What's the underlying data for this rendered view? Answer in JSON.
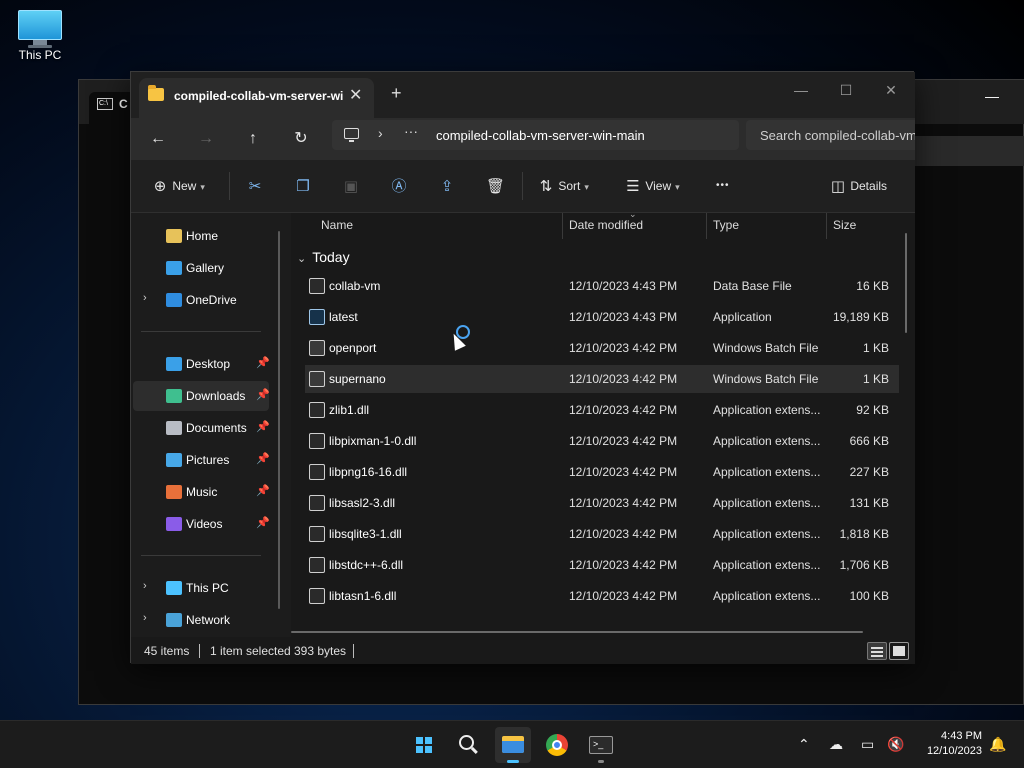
{
  "desktop": {
    "icon_label": "This PC"
  },
  "cmd": {
    "title_char": "C",
    "icon_text": "C:\\"
  },
  "explorer": {
    "tab_title": "compiled-collab-vm-server-wi",
    "tab_close": "✕",
    "new_tab": "+",
    "minimize": "—",
    "maximize": "☐",
    "close": "✕",
    "address": {
      "dots": "···",
      "chevron": "›",
      "path": "compiled-collab-vm-server-win-main"
    },
    "search_placeholder": "Search compiled-collab-vm-server-win-main",
    "commands": {
      "new": "New",
      "sort": "Sort",
      "view": "View",
      "more": "•••",
      "details": "Details"
    },
    "nav": {
      "quick": [
        {
          "label": "Home",
          "icon": "home-icon",
          "color": "#e7c25a"
        },
        {
          "label": "Gallery",
          "icon": "gallery-icon",
          "color": "#3aa0e8"
        },
        {
          "label": "OneDrive",
          "icon": "cloud-icon",
          "color": "#2f8de0"
        }
      ],
      "pinned": [
        {
          "label": "Desktop",
          "icon": "desktop-icon",
          "color": "#3aa0e8"
        },
        {
          "label": "Downloads",
          "icon": "download-icon",
          "color": "#3fbf8f"
        },
        {
          "label": "Documents",
          "icon": "document-icon",
          "color": "#b8bcc4"
        },
        {
          "label": "Pictures",
          "icon": "pictures-icon",
          "color": "#47a8e8"
        },
        {
          "label": "Music",
          "icon": "music-icon",
          "color": "#e8703a"
        },
        {
          "label": "Videos",
          "icon": "video-icon",
          "color": "#8a5ce8"
        }
      ],
      "devices": [
        {
          "label": "This PC",
          "icon": "pc-icon",
          "color": "#4cc2ff"
        },
        {
          "label": "Network",
          "icon": "network-icon",
          "color": "#4aa3d8"
        }
      ]
    },
    "columns": [
      "Name",
      "Date modified",
      "Type",
      "Size"
    ],
    "group": "Today",
    "files": [
      {
        "name": "collab-vm",
        "date": "12/10/2023 4:43 PM",
        "type": "Data Base File",
        "size": "16 KB",
        "kind": "file"
      },
      {
        "name": "latest",
        "date": "12/10/2023 4:43 PM",
        "type": "Application",
        "size": "19,189 KB",
        "kind": "app"
      },
      {
        "name": "openport",
        "date": "12/10/2023 4:42 PM",
        "type": "Windows Batch File",
        "size": "1 KB",
        "kind": "bat"
      },
      {
        "name": "supernano",
        "date": "12/10/2023 4:42 PM",
        "type": "Windows Batch File",
        "size": "1 KB",
        "kind": "bat"
      },
      {
        "name": "zlib1.dll",
        "date": "12/10/2023 4:42 PM",
        "type": "Application extens...",
        "size": "92 KB",
        "kind": "dll"
      },
      {
        "name": "libpixman-1-0.dll",
        "date": "12/10/2023 4:42 PM",
        "type": "Application extens...",
        "size": "666 KB",
        "kind": "dll"
      },
      {
        "name": "libpng16-16.dll",
        "date": "12/10/2023 4:42 PM",
        "type": "Application extens...",
        "size": "227 KB",
        "kind": "dll"
      },
      {
        "name": "libsasl2-3.dll",
        "date": "12/10/2023 4:42 PM",
        "type": "Application extens...",
        "size": "131 KB",
        "kind": "dll"
      },
      {
        "name": "libsqlite3-1.dll",
        "date": "12/10/2023 4:42 PM",
        "type": "Application extens...",
        "size": "1,818 KB",
        "kind": "dll"
      },
      {
        "name": "libstdc++-6.dll",
        "date": "12/10/2023 4:42 PM",
        "type": "Application extens...",
        "size": "1,706 KB",
        "kind": "dll"
      },
      {
        "name": "libtasn1-6.dll",
        "date": "12/10/2023 4:42 PM",
        "type": "Application extens...",
        "size": "100 KB",
        "kind": "dll"
      }
    ],
    "status": {
      "items": "45 items",
      "selected": "1 item selected",
      "size": "393 bytes"
    }
  },
  "taskbar": {
    "time": "4:43 PM",
    "date": "12/10/2023"
  }
}
